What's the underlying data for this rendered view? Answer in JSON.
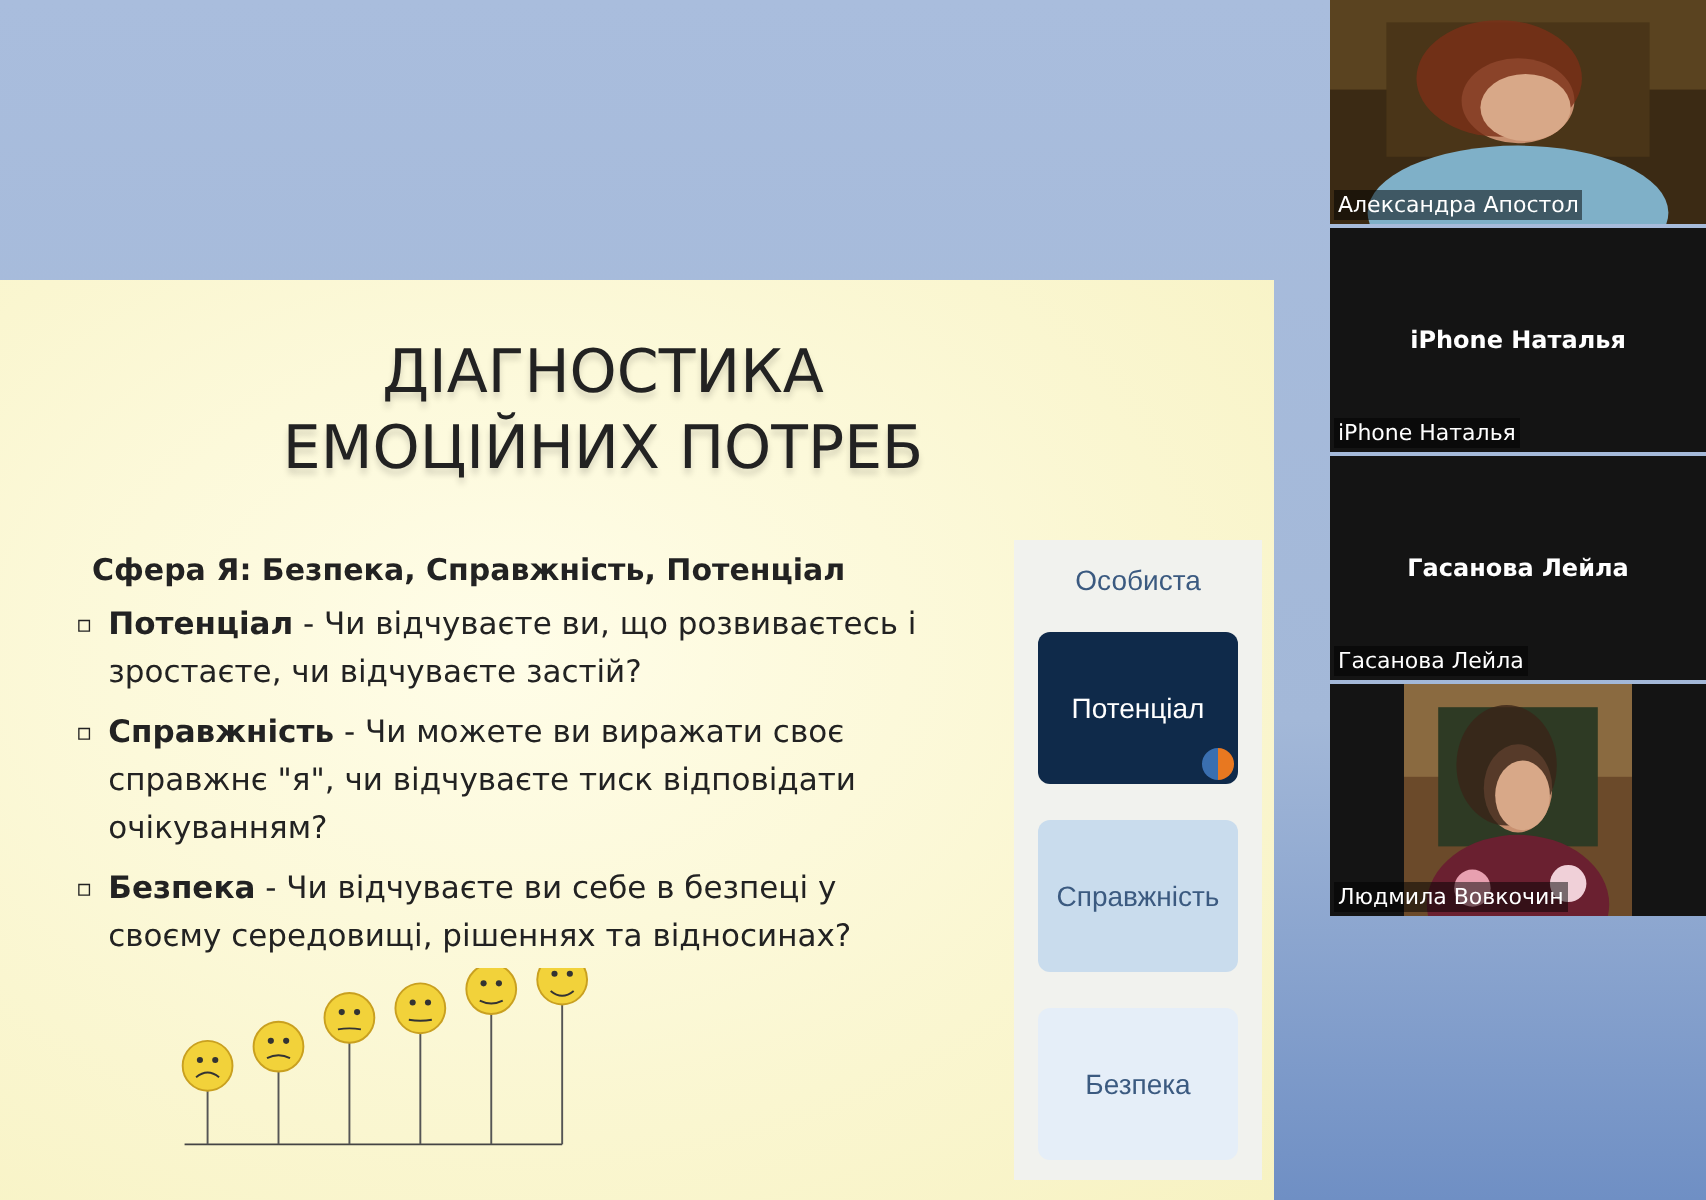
{
  "slide": {
    "title": [
      "ДІАГНОСТИКА",
      "ЕМОЦІЙНИХ ПОТРЕБ"
    ],
    "heading": "Сфера Я: Безпека, Справжність, Потенціал",
    "bullets": [
      {
        "marker": "▫",
        "text": "**Потенціал** - Чи відчуваєте ви, що розвиваєтесь і зростаєте, чи відчуваєте застій?"
      },
      {
        "marker": "▫",
        "text": "**Справжність** - Чи можете ви виражати своє справжнє \"я\", чи відчуваєте тиск відповідати очікуванням?"
      },
      {
        "marker": "▫",
        "text": "**Безпека** - Чи відчуваєте ви себе в безпеці у своєму середовищі, рішеннях та відносинах?"
      }
    ],
    "panel": {
      "title": "Особиста",
      "cards": [
        {
          "label": "Потенціал",
          "selected": true
        },
        {
          "label": "Справжність",
          "selected": false
        },
        {
          "label": "Безпека",
          "selected": false
        }
      ]
    }
  },
  "participants": [
    {
      "kind": "video",
      "name": "Александра Апостол"
    },
    {
      "kind": "avatar",
      "name": "iPhone Наталья",
      "display": "iPhone Наталья"
    },
    {
      "kind": "avatar",
      "name": "Гасанова Лейла",
      "display": "Гасанова Лейла"
    },
    {
      "kind": "video",
      "name": "Людмила Вовкочин"
    }
  ]
}
